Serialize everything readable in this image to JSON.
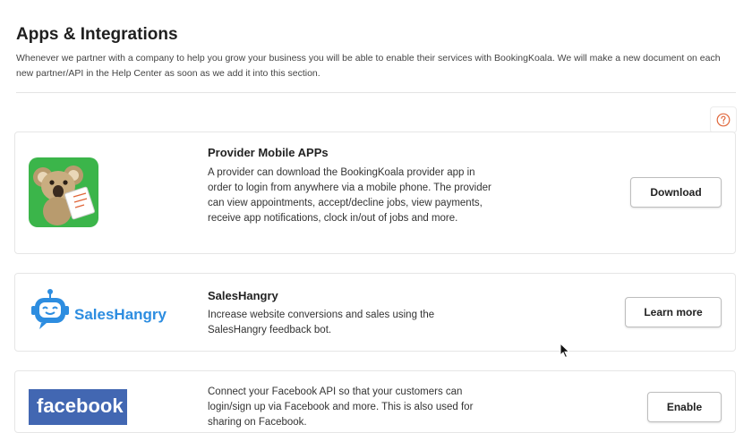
{
  "page": {
    "title": "Apps & Integrations",
    "description": "Whenever we partner with a company to help you grow your business you will be able to enable their services with BookingKoala. We will make a new document on each new partner/API in the Help Center as soon as we add it into this section."
  },
  "help": {
    "icon": "question-circle-icon",
    "color": "#e0663a"
  },
  "integrations": [
    {
      "title": "Provider Mobile APPs",
      "description": "A provider can download the BookingKoala provider app in order to login from anywhere via a mobile phone. The provider can view appointments, accept/decline jobs, view payments, receive app notifications, clock in/out of jobs and more.",
      "button": "Download",
      "logo": "bookingkoala-koala-logo",
      "logo_color": "#3bb54a"
    },
    {
      "title": "SalesHangry",
      "description": "Increase website conversions and sales using the SalesHangry feedback bot.",
      "button": "Learn more",
      "logo": "saleshangry-robot-logo",
      "logo_text": "SalesHangry",
      "logo_color": "#2d8de0"
    },
    {
      "title": "",
      "description": "Connect your Facebook API so that your customers can login/sign up via Facebook and more. This is also used for sharing on Facebook.",
      "button": "Enable",
      "logo": "facebook-logo",
      "logo_text": "facebook",
      "logo_color": "#4267b2"
    }
  ]
}
